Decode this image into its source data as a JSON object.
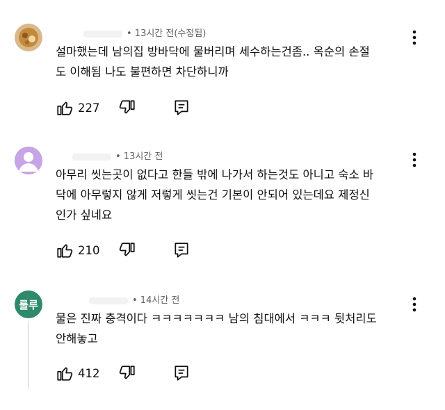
{
  "comments": [
    {
      "timestamp": "• 13시간 전(수정됨)",
      "text_line1": "설마했는데 남의집 방바닥에 물버리며 세수하는건좀..  옥순의 손절",
      "text_line2": "도 이해됨 나도 불편하면 차단하니까",
      "likes": "227",
      "avatar": "photo-avatar"
    },
    {
      "timestamp": "• 13시간 전",
      "text_line1": "아무리 씻는곳이 없다고 한들 밖에 나가서 하는것도 아니고 숙소 바",
      "text_line2": "닥에 아무렇지 않게 저렇게 씻는건 기본이 안되어 있는데요 제정신",
      "text_line3": "인가 싶네요",
      "likes": "210",
      "avatar": "default-person-avatar"
    },
    {
      "timestamp": "• 14시간 전",
      "text_line1": "물은 진짜 충격이다 ㅋㅋㅋㅋㅋㅋㅋ 남의 침대에서 ㅋㅋㅋ 뒷처리도",
      "text_line2": "안해놓고",
      "likes": "412",
      "avatar_label": "룰루"
    }
  ],
  "colors": {
    "meta": "#606060",
    "text": "#0f0f0f",
    "avatar3_bg": "#2e8a6b",
    "avatar2_bg": "#c7a4e6"
  }
}
